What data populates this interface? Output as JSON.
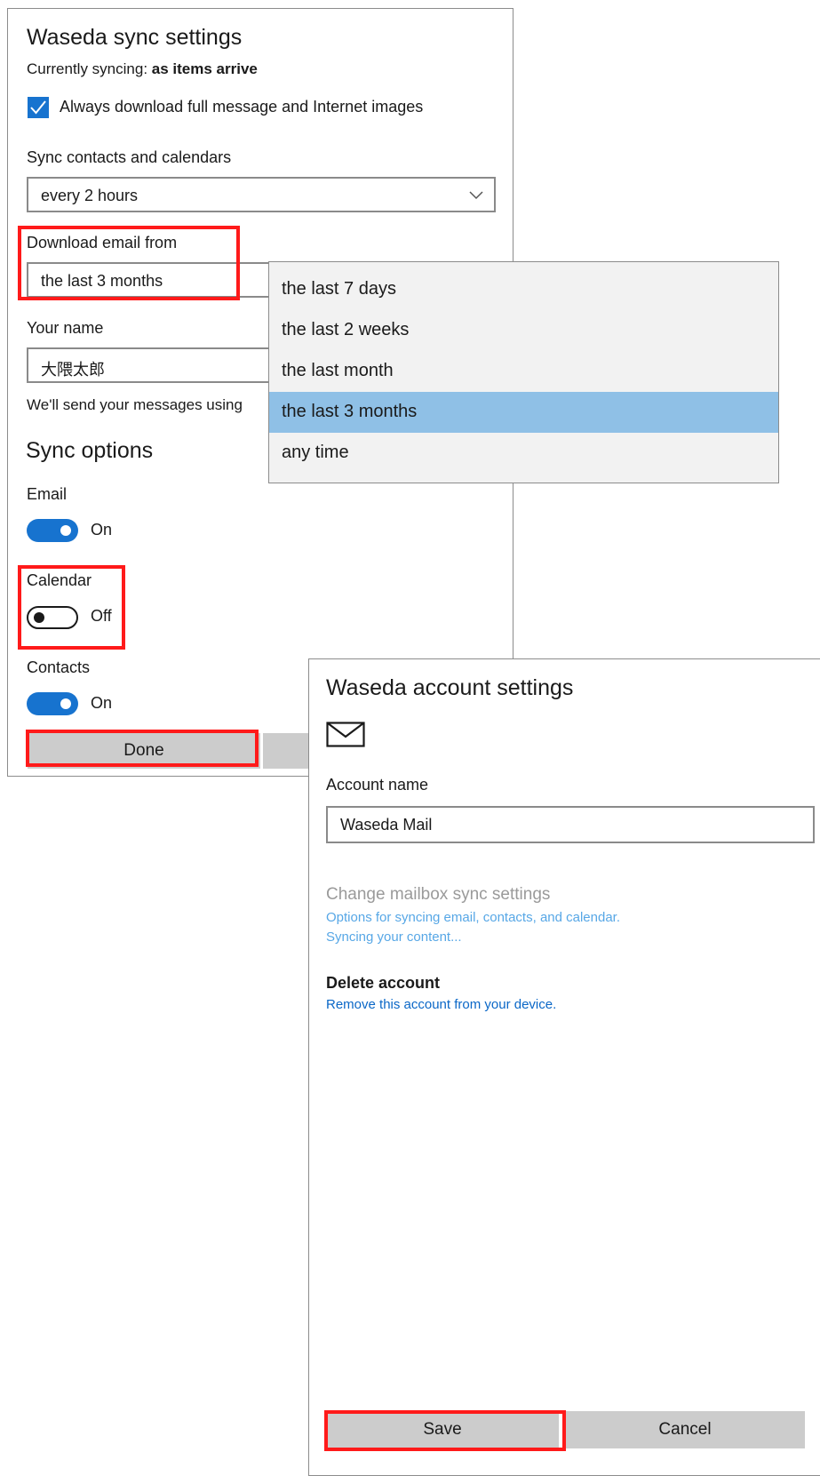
{
  "sync": {
    "title": "Waseda sync settings",
    "currently_prefix": "Currently syncing: ",
    "currently_value": "as items arrive",
    "always_download_label": "Always download full message and Internet images",
    "always_download_checked": true,
    "contacts_calendars_label": "Sync contacts and calendars",
    "contacts_calendars_value": "every 2 hours",
    "download_from_label": "Download email from",
    "download_from_value": "the last 3 months",
    "your_name_label": "Your name",
    "your_name_value": "大隈太郎",
    "send_note": "We'll send your messages using",
    "sync_options_title": "Sync options",
    "email_label": "Email",
    "email_state": "On",
    "calendar_label": "Calendar",
    "calendar_state": "Off",
    "contacts_label": "Contacts",
    "contacts_state": "On",
    "done_label": "Done"
  },
  "dropdown": {
    "options": [
      "the last 7 days",
      "the last 2 weeks",
      "the last month",
      "the last 3 months",
      "any time"
    ],
    "selected_index": 3
  },
  "account": {
    "title": "Waseda account settings",
    "icon": "mail-icon",
    "account_name_label": "Account name",
    "account_name_value": "Waseda Mail",
    "change_sync_title": "Change mailbox sync settings",
    "change_sync_desc": "Options for syncing email, contacts, and calendar.",
    "change_sync_status": "Syncing your content...",
    "delete_title": "Delete account",
    "delete_desc": "Remove this account from your device.",
    "save_label": "Save",
    "cancel_label": "Cancel"
  },
  "colors": {
    "accent": "#1773cf",
    "highlight_box": "#ff1a1a",
    "selected_option": "#8fc0e6",
    "button_gray": "#cccccc"
  }
}
